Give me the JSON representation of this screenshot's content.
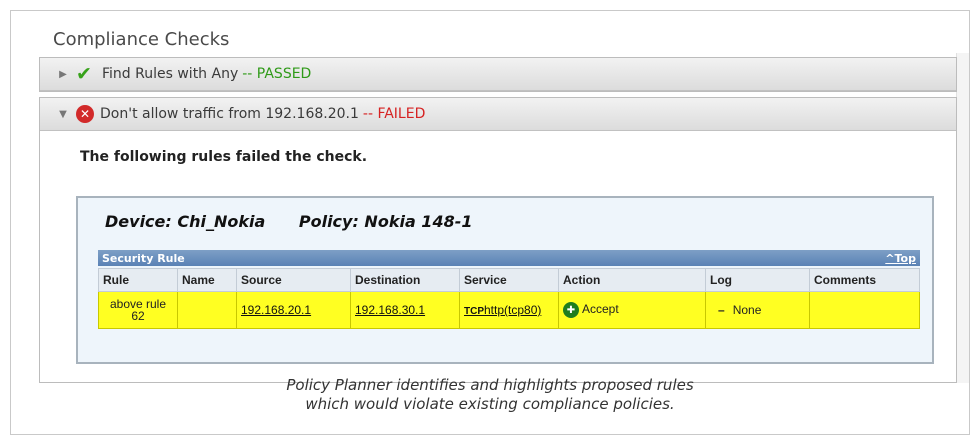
{
  "page": {
    "title": "Compliance Checks"
  },
  "checks": [
    {
      "name": "Find Rules with Any",
      "status": "-- PASSED"
    },
    {
      "name": "Don't allow traffic from 192.168.20.1",
      "status": "-- FAILED",
      "message": "The following rules failed the check."
    }
  ],
  "result": {
    "device": "Device: Chi_Nokia",
    "policy": "Policy: Nokia 148-1",
    "section_title": "Security Rule",
    "top_link": "^Top",
    "columns": [
      "Rule",
      "Name",
      "Source",
      "Destination",
      "Service",
      "Action",
      "Log",
      "Comments"
    ],
    "row": {
      "rule": "above rule 62",
      "name": "",
      "source": "192.168.20.1",
      "destination": "192.168.30.1",
      "service_proto": "TCP",
      "service": "http(tcp80)",
      "action": "Accept",
      "log": "None",
      "comments": ""
    }
  },
  "caption": {
    "line1": "Policy Planner identifies and highlights proposed rules",
    "line2": "which would violate existing compliance policies."
  },
  "colors": {
    "pass": "#2f9a18",
    "fail": "#d62222",
    "highlight": "#ffff22"
  },
  "icons": {
    "expand": "caret-right-icon",
    "collapse": "caret-down-icon",
    "pass": "checkmark-icon",
    "fail": "x-circle-icon",
    "accept": "accept-icon"
  }
}
